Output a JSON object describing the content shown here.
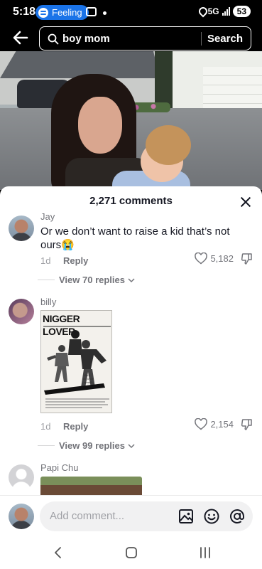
{
  "status_bar": {
    "time": "5:18",
    "spotify_pill_label": "Feeling",
    "network": "5G",
    "battery": "53"
  },
  "search": {
    "query": "boy mom",
    "button_label": "Search"
  },
  "comments_panel": {
    "title": "2,271 comments",
    "comments": [
      {
        "username": "Jay",
        "text": "Or we don’t want to raise a kid that’s not ours😭",
        "age": "1d",
        "reply_label": "Reply",
        "likes": "5,182",
        "view_replies": "View 70 replies"
      },
      {
        "username": "billy",
        "image_caption": "NIGGER LOVER",
        "age": "1d",
        "reply_label": "Reply",
        "likes": "2,154",
        "view_replies": "View 99 replies"
      },
      {
        "username": "Papi Chu"
      }
    ]
  },
  "composer": {
    "placeholder": "Add comment..."
  },
  "colors": {
    "search_pill": "#1a73e8",
    "text_primary": "#161823",
    "text_secondary": "#73747a"
  }
}
